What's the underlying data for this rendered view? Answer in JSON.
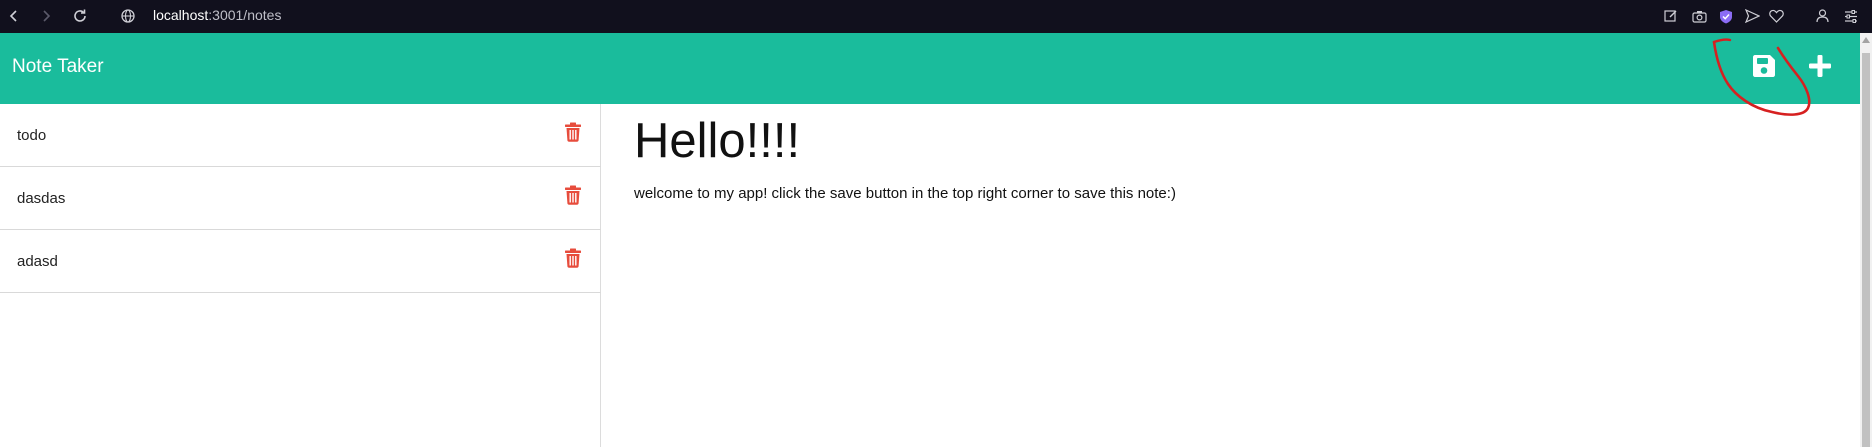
{
  "browser": {
    "url_host": "localhost",
    "url_path": ":3001/notes"
  },
  "header": {
    "title": "Note Taker",
    "save_icon": "floppy-disk-icon",
    "add_icon": "plus-icon"
  },
  "notes": [
    {
      "title": "todo"
    },
    {
      "title": "dasdas"
    },
    {
      "title": "adasd"
    }
  ],
  "active_note": {
    "title": "Hello!!!!",
    "text": "welcome to my app! click the save button in the top right corner to save this note:)"
  },
  "colors": {
    "header_bg": "#1abc9c",
    "delete": "#e74c3c",
    "annotation": "#d62020"
  }
}
